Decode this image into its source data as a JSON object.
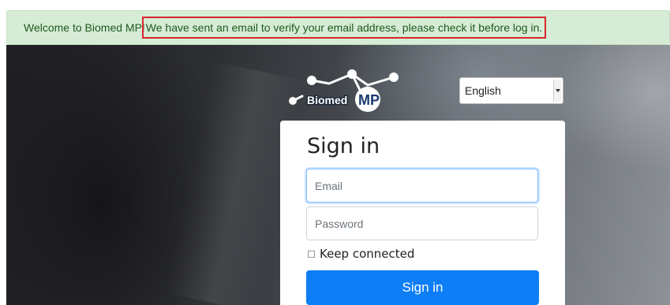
{
  "alert": {
    "welcome": "Welcome to Biomed MP!",
    "message": "We have sent an email to verify your email address, please check it before log in."
  },
  "logo": {
    "word": "Biomed",
    "badge": "MP"
  },
  "language": {
    "selected": "English"
  },
  "signin": {
    "title": "Sign in",
    "email_placeholder": "Email",
    "password_placeholder": "Password",
    "keep_label": "Keep connected",
    "button_label": "Sign in"
  },
  "colors": {
    "alert_bg": "#d6ecd6",
    "alert_text": "#1e5a1e",
    "highlight": "#d9262a",
    "primary": "#0d7ef5"
  },
  "icons": [
    "molecule-logo-icon",
    "dropdown-arrow-icon",
    "checkbox-icon"
  ]
}
